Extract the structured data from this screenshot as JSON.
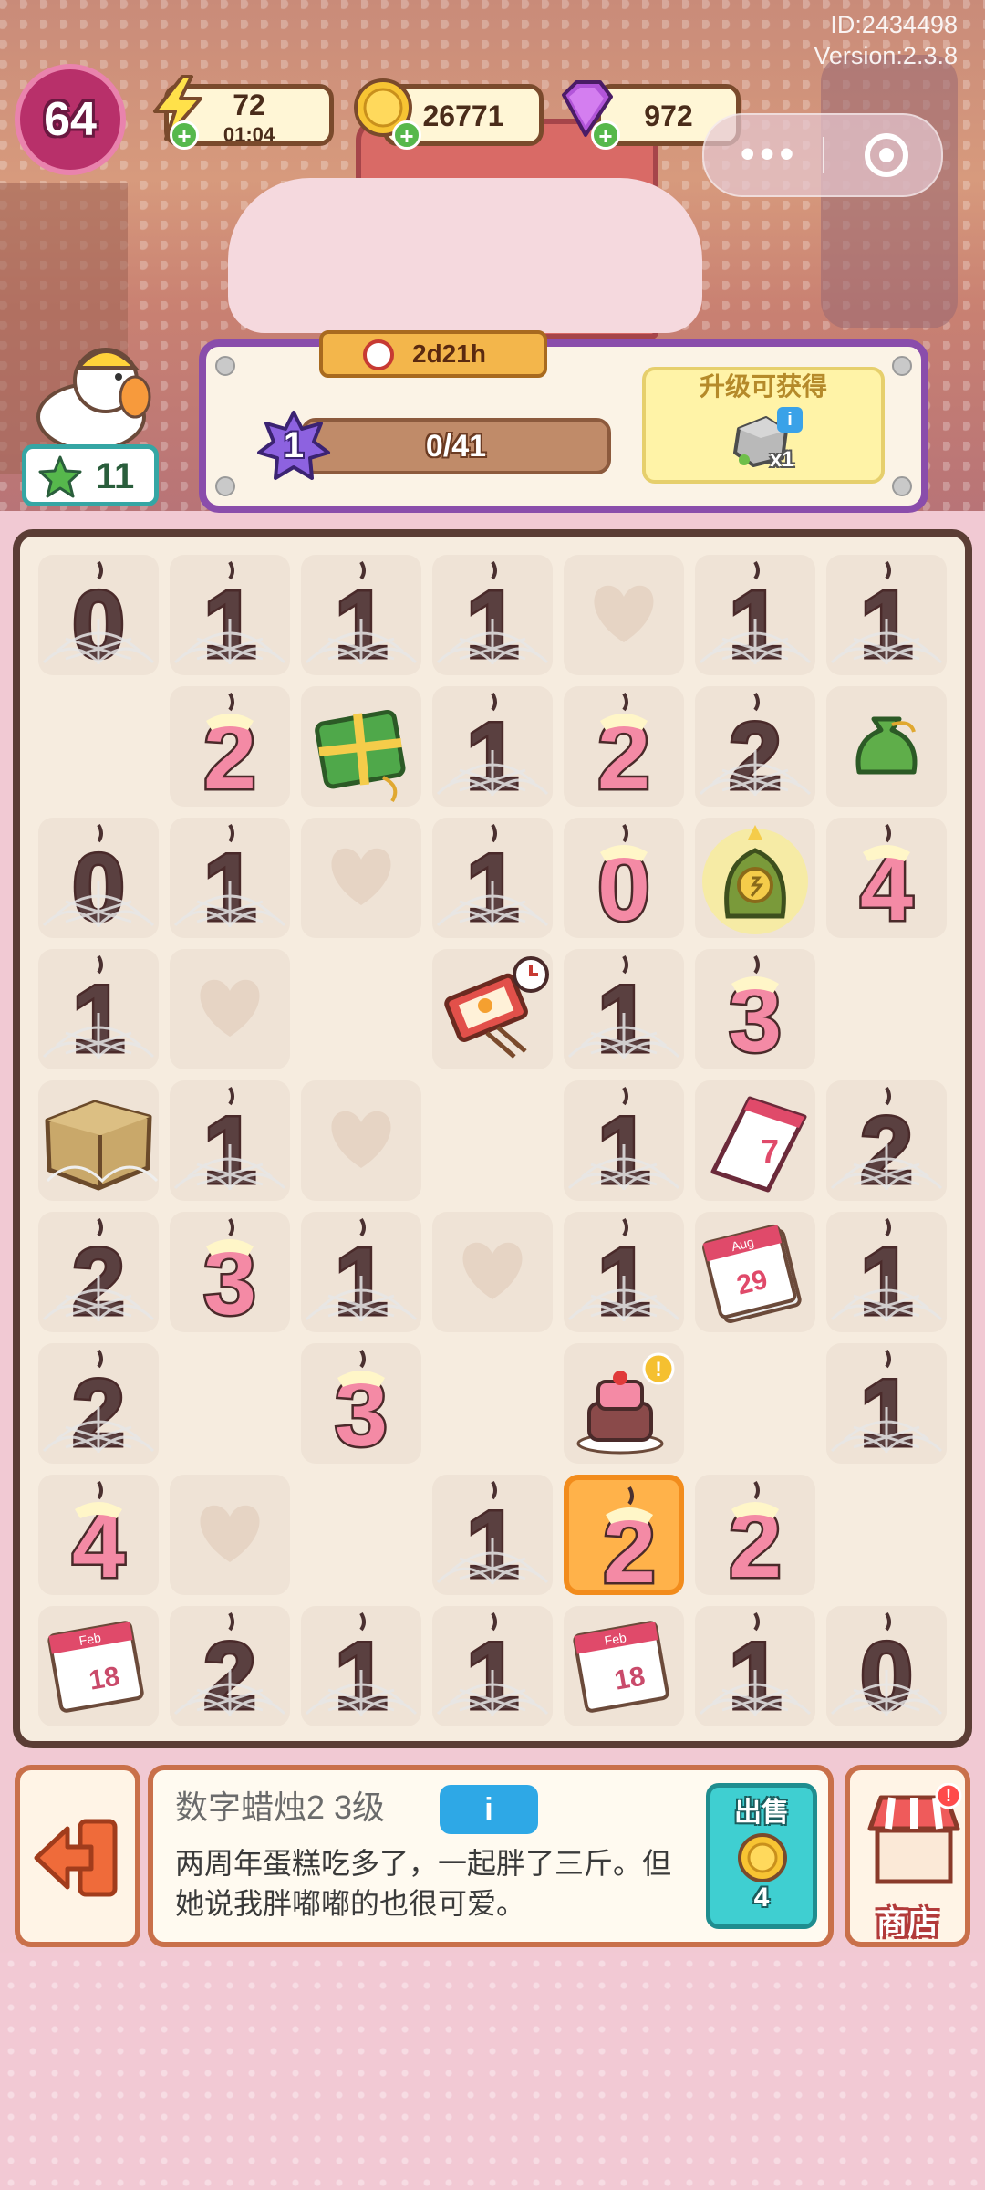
{
  "header": {
    "id_text": "ID:2434498",
    "version_text": "Version:2.3.8",
    "player_level": "64",
    "energy": {
      "value": "72",
      "timer": "01:04"
    },
    "coins": "26771",
    "gems": "972"
  },
  "event": {
    "timer": "2d21h",
    "level": "1",
    "progress_text": "0/41",
    "progress": 0.0,
    "reward_label": "升级可获得",
    "reward_count": "x1"
  },
  "helper": {
    "stars": "11"
  },
  "board": {
    "rows": [
      [
        "cobweb-candle-0",
        "cobweb-candle-1",
        "cobweb-candle-1",
        "cobweb-candle-1",
        "heart-tile",
        "cobweb-candle-1",
        "cobweb-candle-1"
      ],
      [
        "empty",
        "candle-2",
        "gift-box",
        "cobweb-candle-1",
        "candle-2",
        "cobweb-candle-2",
        "money-bag"
      ],
      [
        "cobweb-candle-0",
        "cobweb-candle-1",
        "heart-tile",
        "cobweb-candle-1",
        "candle-0",
        "lucky-cat-generator",
        "candle-4"
      ],
      [
        "cobweb-candle-1",
        "heart-tile",
        "empty",
        "matchbox",
        "cobweb-candle-1",
        "candle-3",
        "empty"
      ],
      [
        "cobweb-box",
        "cobweb-candle-1",
        "heart-tile",
        "empty",
        "cobweb-candle-1",
        "desk-calendar",
        "cobweb-candle-2"
      ],
      [
        "cobweb-candle-2",
        "candle-3",
        "cobweb-candle-1",
        "heart-tile",
        "cobweb-candle-1",
        "calendar-pad",
        "cobweb-candle-1"
      ],
      [
        "cobweb-candle-2",
        "empty",
        "candle-3",
        "empty",
        "birthday-cake",
        "empty",
        "cobweb-candle-1"
      ],
      [
        "candle-4",
        "heart-tile",
        "empty",
        "cobweb-candle-1",
        "candle-2-selected",
        "candle-2",
        "empty"
      ],
      [
        "calendar-page",
        "cobweb-candle-2",
        "cobweb-candle-1",
        "cobweb-candle-1",
        "calendar-page",
        "cobweb-candle-1",
        "cobweb-candle-0"
      ]
    ],
    "calendar_labels": {
      "desk": "7",
      "pad": "29",
      "page": "18",
      "pad_month": "Aug",
      "page_month": "Feb"
    }
  },
  "info": {
    "title": "数字蜡烛2 3级",
    "info_button": "i",
    "description": "两周年蛋糕吃多了，一起胖了三斤。但她说我胖嘟嘟的也很可爱。",
    "sell_label": "出售",
    "sell_price": "4",
    "shop_label": "商店"
  },
  "colors": {
    "candle_pink": "#f48aa5",
    "candle_dark": "#5a4040",
    "board_border": "#5b3d35",
    "event_border": "#8a4dab"
  }
}
